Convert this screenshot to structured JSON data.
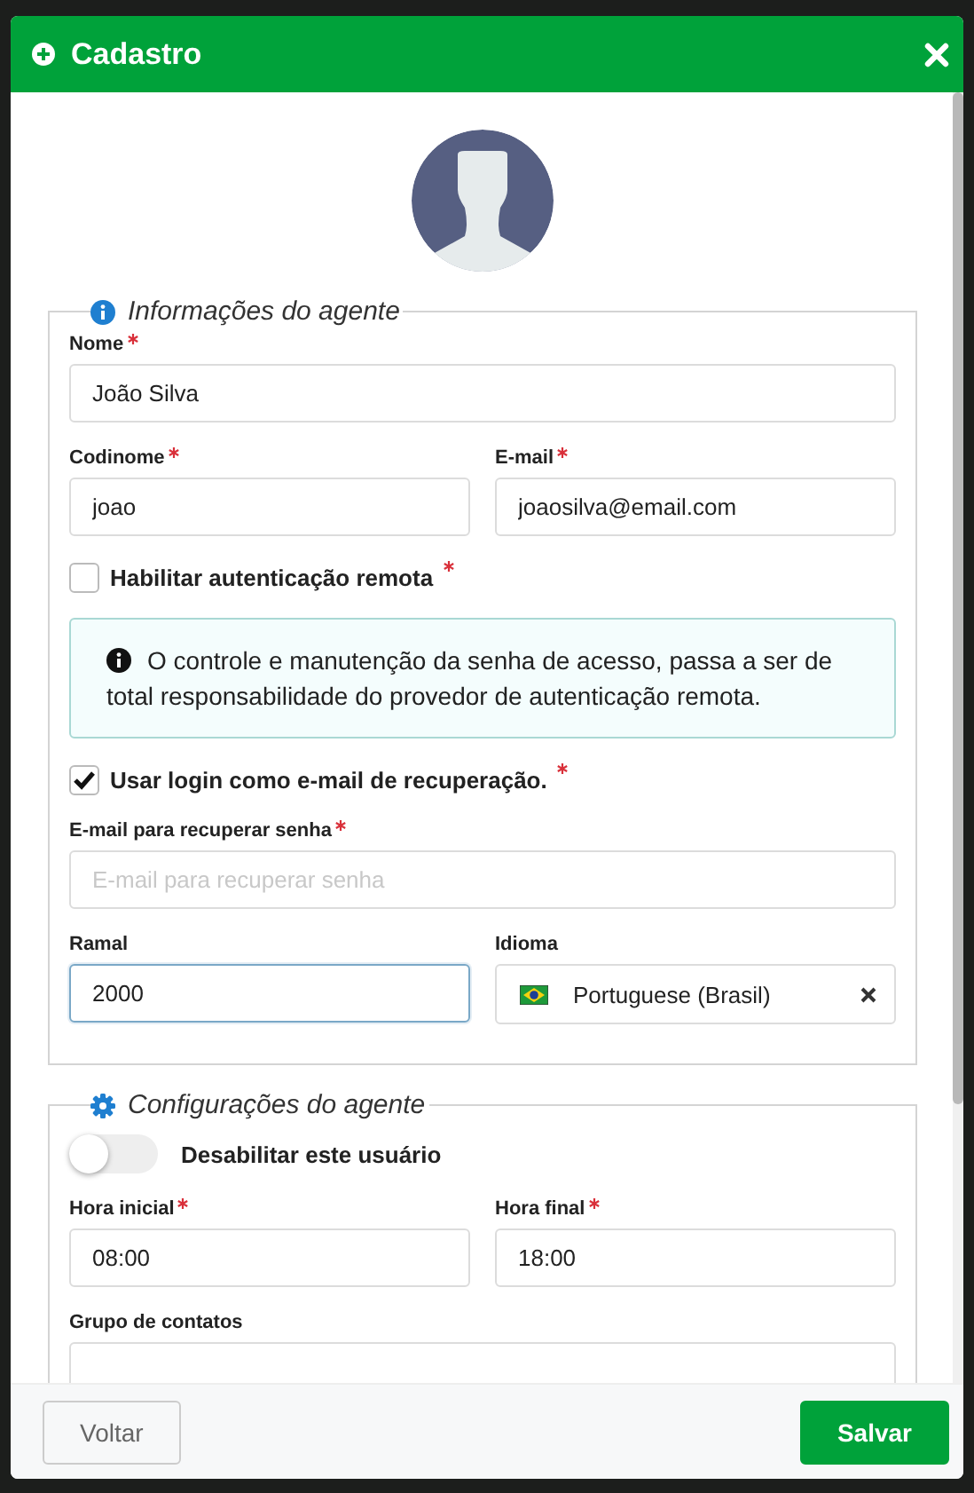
{
  "dialog": {
    "title": "Cadastro"
  },
  "sections": [
    {
      "kind": "info",
      "title": "Informações do agente",
      "rows": [
        [
          {
            "kind": "input",
            "label": "Nome",
            "required": true,
            "value": "João Silva",
            "focused": false
          }
        ],
        [
          {
            "kind": "input",
            "label": "Codinome",
            "required": true,
            "value": "joao",
            "focused": false
          },
          {
            "kind": "input",
            "label": "E-mail",
            "required": true,
            "value": "joaosilva@email.com",
            "focused": false
          }
        ],
        [
          {
            "kind": "checkbox",
            "label": "Habilitar autenticação remota",
            "required": true,
            "checked": false
          }
        ],
        [
          {
            "kind": "notice",
            "text": "O controle e manutenção da senha de acesso, passa a ser de total responsabilidade do provedor de autenticação remota."
          }
        ],
        [
          {
            "kind": "checkbox",
            "label": "Usar login como e-mail de recuperação.",
            "required": true,
            "checked": true
          }
        ],
        [
          {
            "kind": "input",
            "label": "E-mail para recuperar senha",
            "required": true,
            "placeholder": "E-mail para recuperar senha",
            "focused": false
          }
        ],
        [
          {
            "kind": "input",
            "label": "Ramal",
            "required": false,
            "value": "2000",
            "focused": true
          },
          {
            "kind": "select",
            "label": "Idioma",
            "required": false,
            "value": "Portuguese (Brasil)"
          }
        ]
      ]
    },
    {
      "kind": "settings",
      "title": "Configurações do agente",
      "rows": [
        [
          {
            "kind": "toggle",
            "label": "Desabilitar este usuário",
            "on": false
          }
        ],
        [
          {
            "kind": "input",
            "label": "Hora inicial",
            "required": true,
            "value": "08:00",
            "focused": false
          },
          {
            "kind": "input",
            "label": "Hora final",
            "required": true,
            "value": "18:00",
            "focused": false
          }
        ],
        [
          {
            "kind": "input",
            "label": "Grupo de contatos",
            "required": false,
            "focused": false
          }
        ]
      ]
    }
  ],
  "buttons": [
    {
      "kind": "secondary",
      "label": "Voltar"
    },
    {
      "kind": "primary",
      "label": "Salvar"
    }
  ]
}
